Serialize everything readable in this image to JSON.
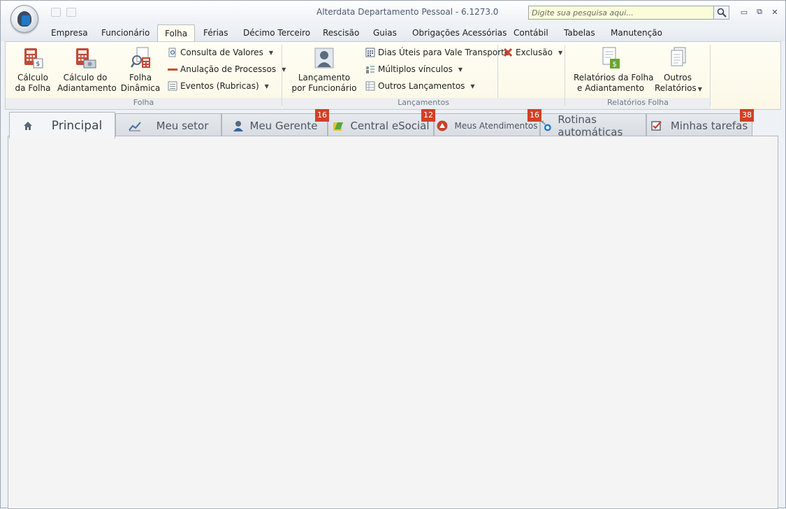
{
  "window": {
    "title": "Alterdata Departamento Pessoal - 6.1273.0",
    "search_placeholder": "Digite sua pesquisa aqui..."
  },
  "menu": {
    "items": [
      "Empresa",
      "Funcionário",
      "Folha",
      "Férias",
      "Décimo Terceiro",
      "Rescisão",
      "Guias",
      "Obrigações Acessórias",
      "Contábil",
      "Tabelas",
      "Manutenção"
    ],
    "active": "Folha"
  },
  "ribbon": {
    "folha": {
      "label": "Folha",
      "calculo_folha": [
        "Cálculo",
        "da Folha"
      ],
      "calculo_adiantamento": [
        "Cálculo do",
        "Adiantamento"
      ],
      "folha_dinamica": [
        "Folha",
        "Dinâmica"
      ],
      "consulta_valores": "Consulta de Valores",
      "anulacao_processos": "Anulação de Processos",
      "eventos_rubricas": "Eventos (Rubricas)"
    },
    "lancamentos": {
      "label": "Lançamentos",
      "lancamento_funcionario": [
        "Lançamento",
        "por Funcionário"
      ],
      "dias_uteis": "Dias Úteis para Vale Transporte",
      "multiplos_vinculos": "Múltiplos vínculos",
      "outros_lancamentos": "Outros Lançamentos",
      "exclusao": "Exclusão"
    },
    "relatorios": {
      "label": "Relatórios Folha",
      "relatorios_folha": [
        "Relatórios da Folha",
        "e Adiantamento"
      ],
      "outros_relatorios": [
        "Outros",
        "Relatórios"
      ]
    }
  },
  "tabs": [
    {
      "label": "Principal",
      "icon": "home-icon",
      "badge": ""
    },
    {
      "label": "Meu setor",
      "icon": "chart-icon",
      "badge": ""
    },
    {
      "label": "Meu Gerente",
      "icon": "person-icon",
      "badge": "16"
    },
    {
      "label": "Central eSocial",
      "icon": "esocial-icon",
      "badge": "12"
    },
    {
      "label": "Meus Atendimentos",
      "icon": "attendance-icon",
      "badge": "16"
    },
    {
      "label": "Rotinas automáticas",
      "icon": "routine-icon",
      "badge": ""
    },
    {
      "label": "Minhas tarefas",
      "icon": "checkbox-icon",
      "badge": "38"
    }
  ],
  "colors": {
    "badge": "#d24026",
    "ribbon_bg": "#fffef4",
    "title_text": "#4a5b73"
  }
}
